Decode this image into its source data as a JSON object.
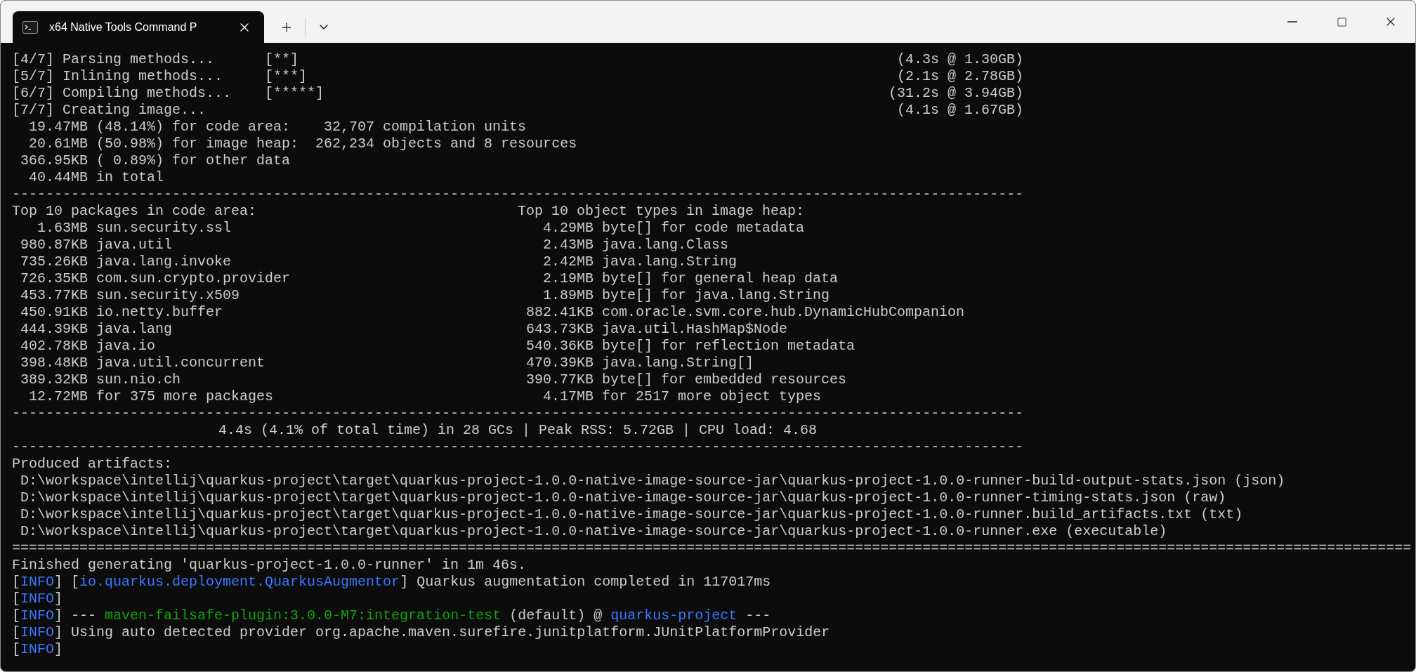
{
  "window": {
    "tab": {
      "title": "x64 Native Tools Command P",
      "selected": true
    }
  },
  "terminal": {
    "lines": [
      {
        "kind": "progress",
        "step": "[4/7] Parsing methods...",
        "marker": "[**]",
        "timing": "(4.3s @ 1.30GB)"
      },
      {
        "kind": "progress",
        "step": "[5/7] Inlining methods...",
        "marker": "[***]",
        "timing": "(2.1s @ 2.78GB)"
      },
      {
        "kind": "progress",
        "step": "[6/7] Compiling methods...",
        "marker": "[*****]",
        "timing": "(31.2s @ 3.94GB)"
      },
      {
        "kind": "progress",
        "step": "[7/7] Creating image...",
        "timing": "(4.1s @ 1.67GB)"
      },
      {
        "kind": "text",
        "text": "  19.47MB (48.14%) for code area:    32,707 compilation units"
      },
      {
        "kind": "text",
        "text": "  20.61MB (50.98%) for image heap:  262,234 objects and 8 resources"
      },
      {
        "kind": "text",
        "text": " 366.95KB ( 0.89%) for other data"
      },
      {
        "kind": "text",
        "text": "  40.44MB in total"
      },
      {
        "kind": "rule",
        "text": "------------------------------------------------------------------------------------------------------------------------"
      },
      {
        "kind": "heading",
        "left": "Top 10 packages in code area:",
        "right": "Top 10 object types in image heap:"
      },
      {
        "kind": "entry",
        "left": {
          "size": "1.63MB",
          "name": "sun.security.ssl"
        },
        "right": {
          "size": "4.29MB",
          "name": "byte[] for code metadata"
        }
      },
      {
        "kind": "entry",
        "left": {
          "size": "980.87KB",
          "name": "java.util"
        },
        "right": {
          "size": "2.43MB",
          "name": "java.lang.Class"
        }
      },
      {
        "kind": "entry",
        "left": {
          "size": "735.26KB",
          "name": "java.lang.invoke"
        },
        "right": {
          "size": "2.42MB",
          "name": "java.lang.String"
        }
      },
      {
        "kind": "entry",
        "left": {
          "size": "726.35KB",
          "name": "com.sun.crypto.provider"
        },
        "right": {
          "size": "2.19MB",
          "name": "byte[] for general heap data"
        }
      },
      {
        "kind": "entry",
        "left": {
          "size": "453.77KB",
          "name": "sun.security.x509"
        },
        "right": {
          "size": "1.89MB",
          "name": "byte[] for java.lang.String"
        }
      },
      {
        "kind": "entry",
        "left": {
          "size": "450.91KB",
          "name": "io.netty.buffer"
        },
        "right": {
          "size": "882.41KB",
          "name": "com.oracle.svm.core.hub.DynamicHubCompanion"
        }
      },
      {
        "kind": "entry",
        "left": {
          "size": "444.39KB",
          "name": "java.lang"
        },
        "right": {
          "size": "643.73KB",
          "name": "java.util.HashMap$Node"
        }
      },
      {
        "kind": "entry",
        "left": {
          "size": "402.78KB",
          "name": "java.io"
        },
        "right": {
          "size": "540.36KB",
          "name": "byte[] for reflection metadata"
        }
      },
      {
        "kind": "entry",
        "left": {
          "size": "398.48KB",
          "name": "java.util.concurrent"
        },
        "right": {
          "size": "470.39KB",
          "name": "java.lang.String[]"
        }
      },
      {
        "kind": "entry",
        "left": {
          "size": "389.32KB",
          "name": "sun.nio.ch"
        },
        "right": {
          "size": "390.77KB",
          "name": "byte[] for embedded resources"
        }
      },
      {
        "kind": "entry",
        "left": {
          "size": "12.72MB",
          "name": "for 375 more packages"
        },
        "right": {
          "size": "4.17MB",
          "name": "for 2517 more object types"
        }
      },
      {
        "kind": "rule",
        "text": "------------------------------------------------------------------------------------------------------------------------"
      },
      {
        "kind": "centered",
        "text": "4.4s (4.1% of total time) in 28 GCs | Peak RSS: 5.72GB | CPU load: 4.68"
      },
      {
        "kind": "rule",
        "text": "------------------------------------------------------------------------------------------------------------------------"
      },
      {
        "kind": "text",
        "text": "Produced artifacts:"
      },
      {
        "kind": "text",
        "text": " D:\\workspace\\intellij\\quarkus-project\\target\\quarkus-project-1.0.0-native-image-source-jar\\quarkus-project-1.0.0-runner-build-output-stats.json (json)"
      },
      {
        "kind": "text",
        "text": " D:\\workspace\\intellij\\quarkus-project\\target\\quarkus-project-1.0.0-native-image-source-jar\\quarkus-project-1.0.0-runner-timing-stats.json (raw)"
      },
      {
        "kind": "text",
        "text": " D:\\workspace\\intellij\\quarkus-project\\target\\quarkus-project-1.0.0-native-image-source-jar\\quarkus-project-1.0.0-runner.build_artifacts.txt (txt)"
      },
      {
        "kind": "text",
        "text": " D:\\workspace\\intellij\\quarkus-project\\target\\quarkus-project-1.0.0-native-image-source-jar\\quarkus-project-1.0.0-runner.exe (executable)"
      },
      {
        "kind": "rule",
        "text": "======================================================================================================================================================================"
      },
      {
        "kind": "text",
        "text": "Finished generating 'quarkus-project-1.0.0-runner' in 1m 46s."
      },
      {
        "kind": "log",
        "segments": [
          {
            "kind": "plain",
            "text": "["
          },
          {
            "kind": "level",
            "text": "INFO"
          },
          {
            "kind": "plain",
            "text": "] ["
          },
          {
            "kind": "class",
            "text": "io.quarkus.deployment.QuarkusAugmentor"
          },
          {
            "kind": "plain",
            "text": "] Quarkus augmentation completed in 117017ms"
          }
        ]
      },
      {
        "kind": "log",
        "segments": [
          {
            "kind": "plain",
            "text": "["
          },
          {
            "kind": "level",
            "text": "INFO"
          },
          {
            "kind": "plain",
            "text": "]"
          }
        ]
      },
      {
        "kind": "log",
        "segments": [
          {
            "kind": "plain",
            "text": "["
          },
          {
            "kind": "level",
            "text": "INFO"
          },
          {
            "kind": "plain",
            "text": "] --- "
          },
          {
            "kind": "plugin",
            "text": "maven-failsafe-plugin:3.0.0-M7:integration-test"
          },
          {
            "kind": "plain",
            "text": " (default) @ "
          },
          {
            "kind": "project",
            "text": "quarkus-project"
          },
          {
            "kind": "plain",
            "text": " ---"
          }
        ]
      },
      {
        "kind": "log",
        "segments": [
          {
            "kind": "plain",
            "text": "["
          },
          {
            "kind": "level",
            "text": "INFO"
          },
          {
            "kind": "plain",
            "text": "] Using auto detected provider org.apache.maven.surefire.junitplatform.JUnitPlatformProvider"
          }
        ]
      },
      {
        "kind": "log",
        "segments": [
          {
            "kind": "plain",
            "text": "["
          },
          {
            "kind": "level",
            "text": "INFO"
          },
          {
            "kind": "plain",
            "text": "]"
          }
        ]
      }
    ]
  }
}
